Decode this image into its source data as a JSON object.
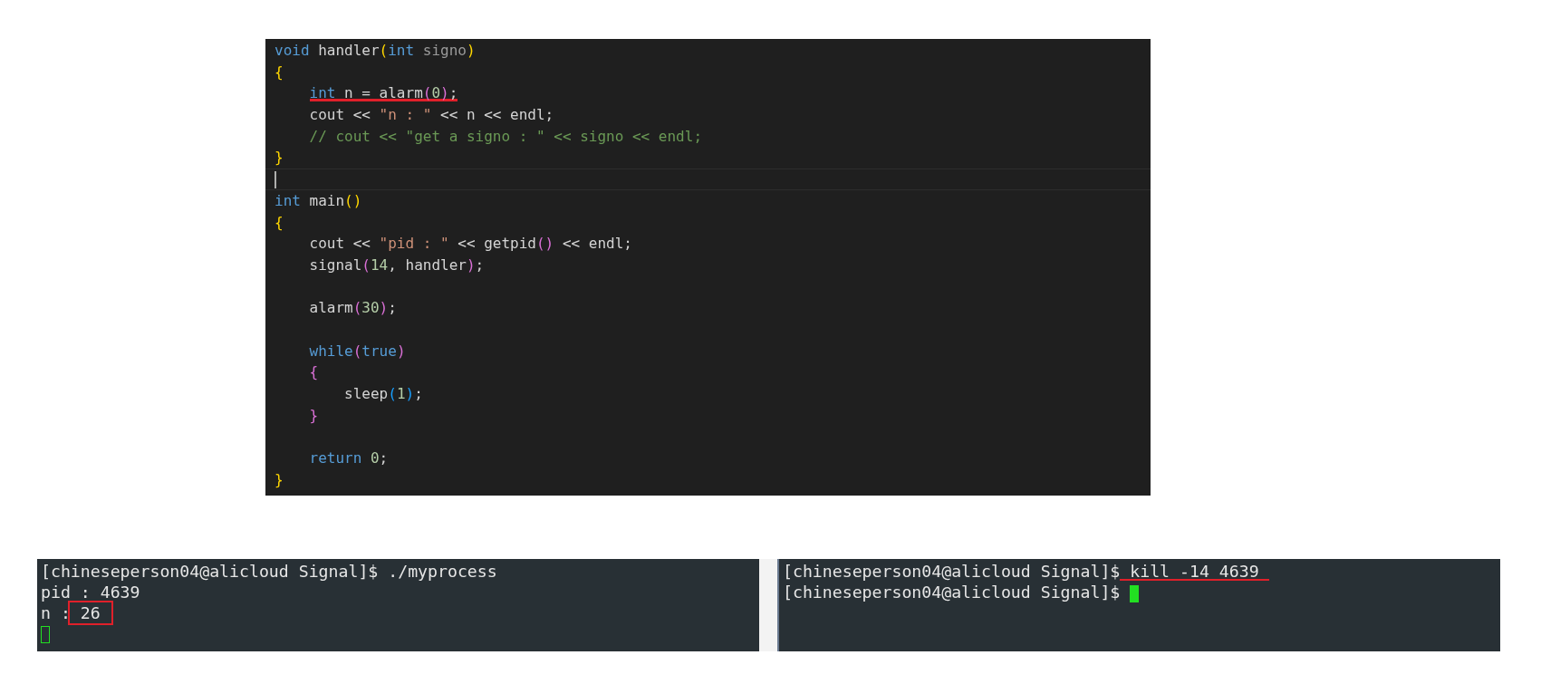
{
  "editor": {
    "lines": [
      {
        "current": false,
        "tokens": [
          {
            "text": "void",
            "kind": "keyword"
          },
          {
            "text": " handler",
            "kind": "plain"
          },
          {
            "text": "(",
            "kind": "bracket1"
          },
          {
            "text": "int",
            "kind": "keyword"
          },
          {
            "text": " signo",
            "kind": "param"
          },
          {
            "text": ")",
            "kind": "bracket1"
          }
        ]
      },
      {
        "current": false,
        "tokens": [
          {
            "text": "{",
            "kind": "bracket1"
          }
        ]
      },
      {
        "current": false,
        "underlined": true,
        "tokens": [
          {
            "text": "    int",
            "kind": "keyword"
          },
          {
            "text": " n = alarm",
            "kind": "plain"
          },
          {
            "text": "(",
            "kind": "bracket2"
          },
          {
            "text": "0",
            "kind": "number"
          },
          {
            "text": ")",
            "kind": "bracket2"
          },
          {
            "text": ";",
            "kind": "plain"
          }
        ]
      },
      {
        "current": false,
        "tokens": [
          {
            "text": "    cout << ",
            "kind": "plain"
          },
          {
            "text": "\"n : \"",
            "kind": "string"
          },
          {
            "text": " << n << endl;",
            "kind": "plain"
          }
        ]
      },
      {
        "current": false,
        "tokens": [
          {
            "text": "    // cout << \"get a signo : \" << signo << endl;",
            "kind": "comment"
          }
        ]
      },
      {
        "current": false,
        "tokens": [
          {
            "text": "}",
            "kind": "bracket1"
          }
        ]
      },
      {
        "current": true
      },
      {
        "current": false,
        "tokens": [
          {
            "text": "int",
            "kind": "keyword"
          },
          {
            "text": " main",
            "kind": "plain"
          },
          {
            "text": "()",
            "kind": "bracket1"
          }
        ]
      },
      {
        "current": false,
        "tokens": [
          {
            "text": "{",
            "kind": "bracket1"
          }
        ]
      },
      {
        "current": false,
        "tokens": [
          {
            "text": "    cout << ",
            "kind": "plain"
          },
          {
            "text": "\"pid : \"",
            "kind": "string"
          },
          {
            "text": " << getpid",
            "kind": "plain"
          },
          {
            "text": "()",
            "kind": "bracket2"
          },
          {
            "text": " << endl;",
            "kind": "plain"
          }
        ]
      },
      {
        "current": false,
        "tokens": [
          {
            "text": "    signal",
            "kind": "plain"
          },
          {
            "text": "(",
            "kind": "bracket2"
          },
          {
            "text": "14",
            "kind": "number"
          },
          {
            "text": ", handler",
            "kind": "plain"
          },
          {
            "text": ")",
            "kind": "bracket2"
          },
          {
            "text": ";",
            "kind": "plain"
          }
        ]
      },
      {
        "current": false
      },
      {
        "current": false,
        "tokens": [
          {
            "text": "    alarm",
            "kind": "plain"
          },
          {
            "text": "(",
            "kind": "bracket2"
          },
          {
            "text": "30",
            "kind": "number"
          },
          {
            "text": ")",
            "kind": "bracket2"
          },
          {
            "text": ";",
            "kind": "plain"
          }
        ]
      },
      {
        "current": false
      },
      {
        "current": false,
        "tokens": [
          {
            "text": "    while",
            "kind": "keyword"
          },
          {
            "text": "(",
            "kind": "bracket2"
          },
          {
            "text": "true",
            "kind": "keyword"
          },
          {
            "text": ")",
            "kind": "bracket2"
          }
        ]
      },
      {
        "current": false,
        "tokens": [
          {
            "text": "    {",
            "kind": "bracket2"
          }
        ]
      },
      {
        "current": false,
        "tokens": [
          {
            "text": "        sleep",
            "kind": "plain"
          },
          {
            "text": "(",
            "kind": "bracket3"
          },
          {
            "text": "1",
            "kind": "number"
          },
          {
            "text": ")",
            "kind": "bracket3"
          },
          {
            "text": ";",
            "kind": "plain"
          }
        ]
      },
      {
        "current": false,
        "tokens": [
          {
            "text": "    }",
            "kind": "bracket2"
          }
        ]
      },
      {
        "current": false
      },
      {
        "current": false,
        "tokens": [
          {
            "text": "    return ",
            "kind": "keyword"
          },
          {
            "text": "0",
            "kind": "number"
          },
          {
            "text": ";",
            "kind": "plain"
          }
        ]
      },
      {
        "current": false,
        "tokens": [
          {
            "text": "}",
            "kind": "bracket1"
          }
        ]
      }
    ]
  },
  "terminals": [
    {
      "lines": [
        {
          "segments": [
            {
              "text": "[chineseperson04@alicloud Signal]$ ./myprocess"
            }
          ]
        },
        {
          "segments": [
            {
              "text": "pid : 4639"
            }
          ]
        },
        {
          "segments": [
            {
              "text": "n :"
            },
            {
              "text": " 26 ",
              "boxed": true
            }
          ]
        }
      ],
      "hollow_cursor": true
    },
    {
      "lines": [
        {
          "segments": [
            {
              "text": "[chineseperson04@alicloud Signal]$"
            },
            {
              "text": " kill -14 4639 ",
              "underlined": true
            }
          ]
        },
        {
          "segments": [
            {
              "text": "[chineseperson04@alicloud Signal]$ "
            }
          ]
        }
      ],
      "hollow_cursor": false
    }
  ]
}
